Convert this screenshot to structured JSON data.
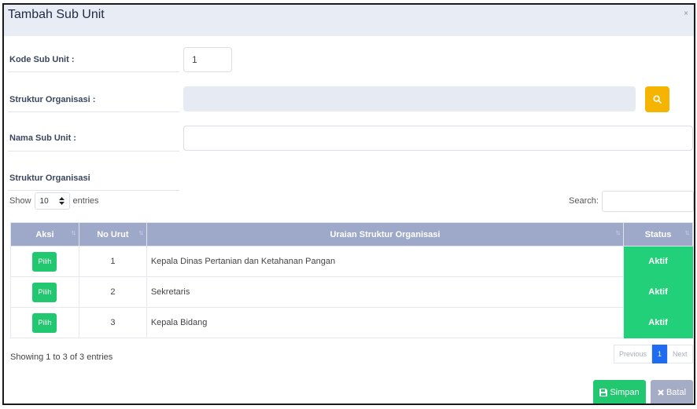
{
  "modal": {
    "title": "Tambah Sub Unit",
    "close": "×"
  },
  "form": {
    "kode_label": "Kode Sub Unit :",
    "kode_value": "1",
    "struktur_label": "Struktur Organisasi :",
    "struktur_value": "",
    "nama_label": "Nama Sub Unit :",
    "nama_value": "",
    "section_label": "Struktur Organisasi"
  },
  "table_controls": {
    "show_label": "Show",
    "entries_value": "10",
    "entries_label": "entries",
    "search_label": "Search:",
    "search_value": ""
  },
  "table": {
    "headers": [
      "Aksi",
      "No Urut",
      "Uraian Struktur Organisasi",
      "Status"
    ],
    "rows": [
      {
        "action": "Pilih",
        "no": "1",
        "uraian": "Kepala Dinas Pertanian dan Ketahanan Pangan",
        "status": "Aktif"
      },
      {
        "action": "Pilih",
        "no": "2",
        "uraian": "Sekretaris",
        "status": "Aktif"
      },
      {
        "action": "Pilih",
        "no": "3",
        "uraian": "Kepala Bidang",
        "status": "Aktif"
      }
    ]
  },
  "footer": {
    "info": "Showing 1 to 3 of 3 entries",
    "prev": "Previous",
    "page": "1",
    "next": "Next"
  },
  "buttons": {
    "simpan": "Simpan",
    "batal": "Batal"
  },
  "colors": {
    "header_bg": "#e8ecf4",
    "table_header": "#9ea8c9",
    "status_green": "#22d07a",
    "search_btn": "#f5b400",
    "page_active": "#1f6bf2"
  },
  "icons": {
    "search": "search-icon",
    "sort": "sort-icon",
    "select_arrows": "select-arrows-icon",
    "save": "save-icon",
    "cancel": "close-icon"
  }
}
